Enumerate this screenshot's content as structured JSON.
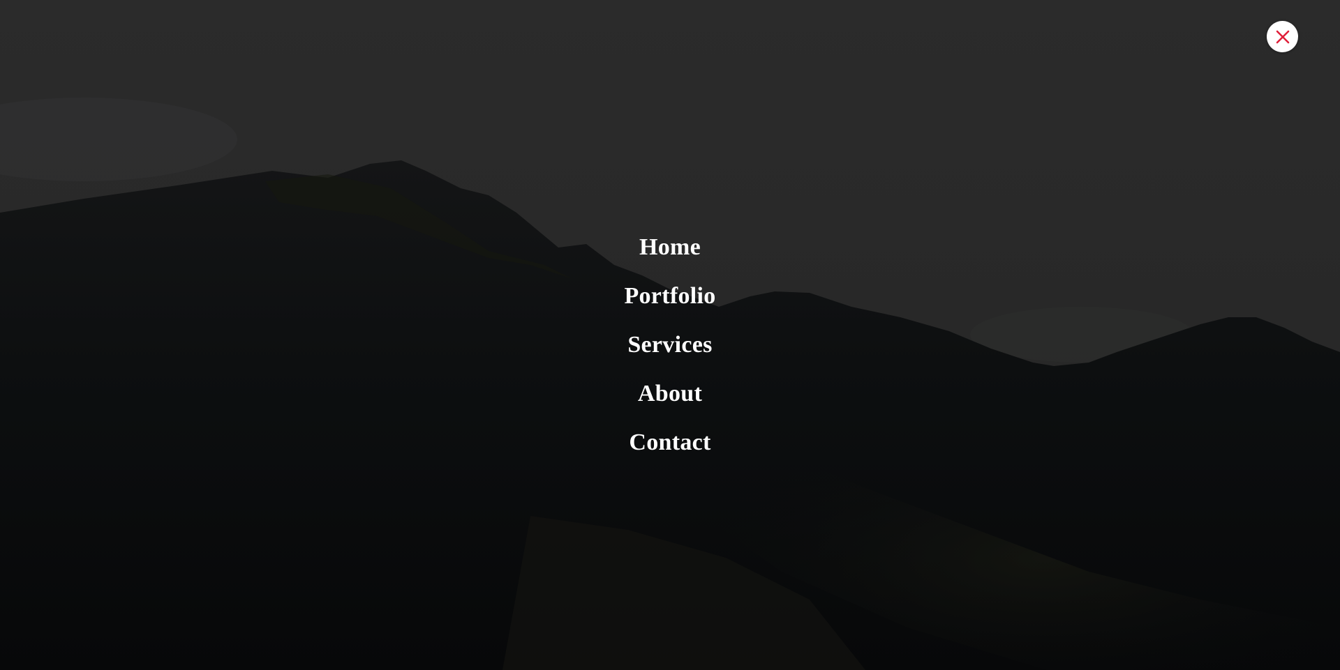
{
  "overlay": {
    "close_icon": "close-icon",
    "close_button_color": "#ffffff",
    "close_icon_color": "#e0203a"
  },
  "nav": {
    "items": [
      {
        "label": "Home"
      },
      {
        "label": "Portfolio"
      },
      {
        "label": "Services"
      },
      {
        "label": "About"
      },
      {
        "label": "Contact"
      }
    ]
  },
  "background": {
    "description_icon": "mountain-landscape-image",
    "sky_color": "#2a2a2a",
    "mountain_color": "#0b0d0e"
  }
}
